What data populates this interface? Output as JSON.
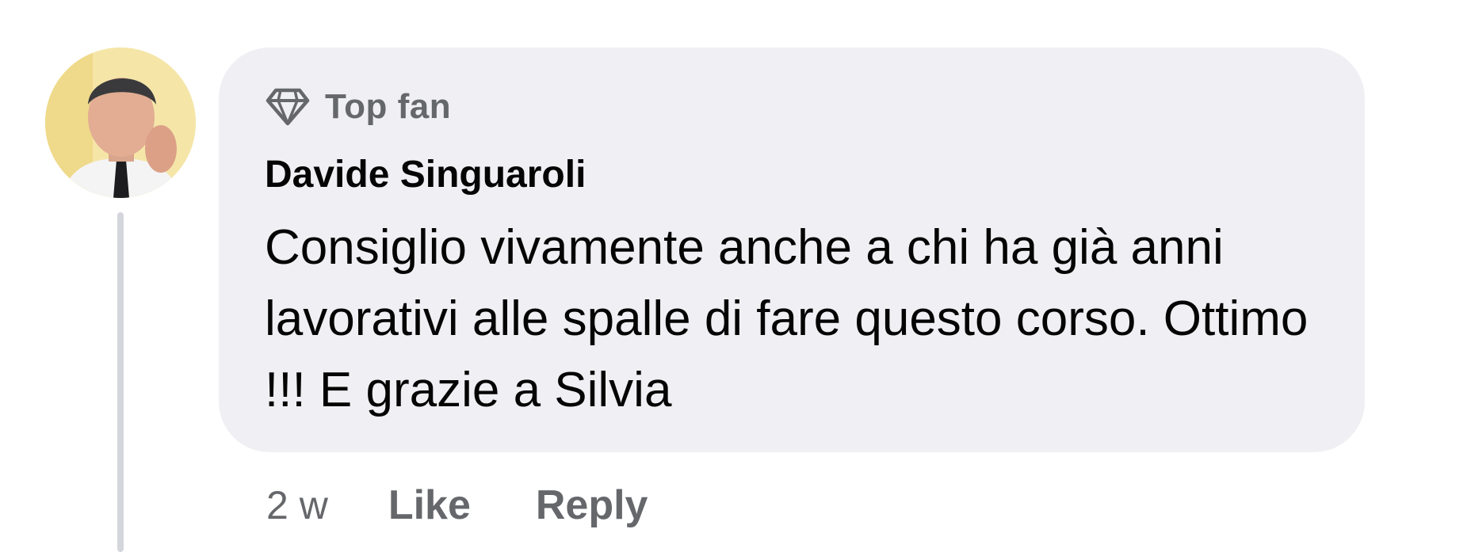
{
  "comment": {
    "badge": {
      "icon": "diamond-icon",
      "label": "Top fan"
    },
    "author": "Davide Singuaroli",
    "text": "Consiglio vivamente anche a chi ha già anni lavorativi alle spalle di fare questo corso. Ottimo !!! E grazie a Silvia",
    "timestamp": "2 w",
    "actions": {
      "like_label": "Like",
      "reply_label": "Reply"
    }
  },
  "colors": {
    "bubble_background": "#f0f0f4",
    "secondary_text": "#65676b",
    "primary_text": "#050505",
    "thread_line": "#d4d6db"
  }
}
